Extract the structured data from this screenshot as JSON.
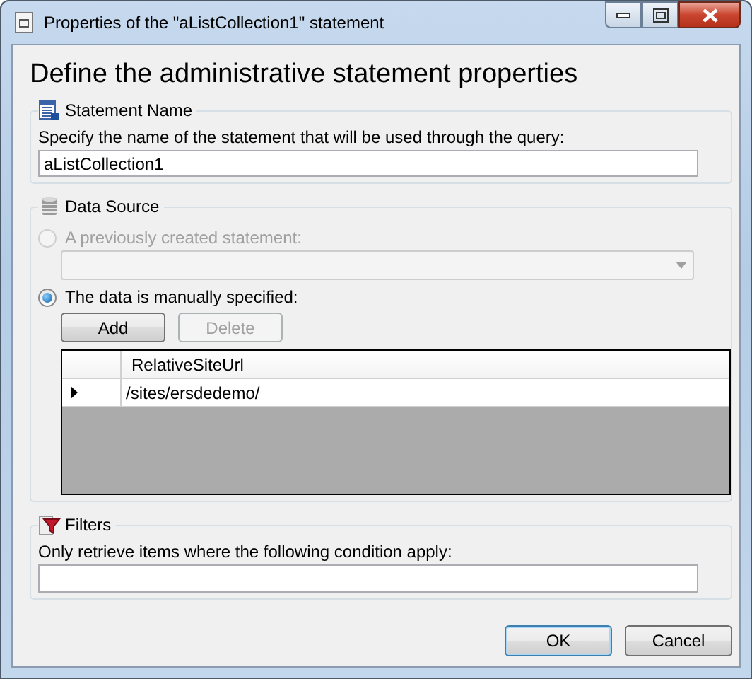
{
  "window": {
    "title": "Properties of the \"aListCollection1\" statement"
  },
  "heading": "Define the administrative statement properties",
  "statement_name": {
    "title": "Statement Name",
    "label": "Specify the name of the statement that will be used through the query:",
    "value": "aListCollection1"
  },
  "data_source": {
    "title": "Data Source",
    "options": [
      {
        "label": "A previously created statement:",
        "selected": false,
        "disabled": true
      },
      {
        "label": "The data is manually specified:",
        "selected": true,
        "disabled": false
      }
    ],
    "statement_dropdown": {
      "disabled": true
    },
    "buttons": [
      {
        "label": "Add",
        "disabled": false
      },
      {
        "label": "Delete",
        "disabled": true
      }
    ],
    "grid": {
      "columns": [
        "RelativeSiteUrl"
      ],
      "rows": [
        {
          "current": true,
          "cells": [
            "/sites/ersdedemo/"
          ]
        }
      ]
    }
  },
  "filters": {
    "title": "Filters",
    "label": "Only retrieve items where the following condition apply:"
  },
  "buttons": [
    {
      "label": "OK",
      "default": true
    },
    {
      "label": "Cancel",
      "default": false
    }
  ]
}
